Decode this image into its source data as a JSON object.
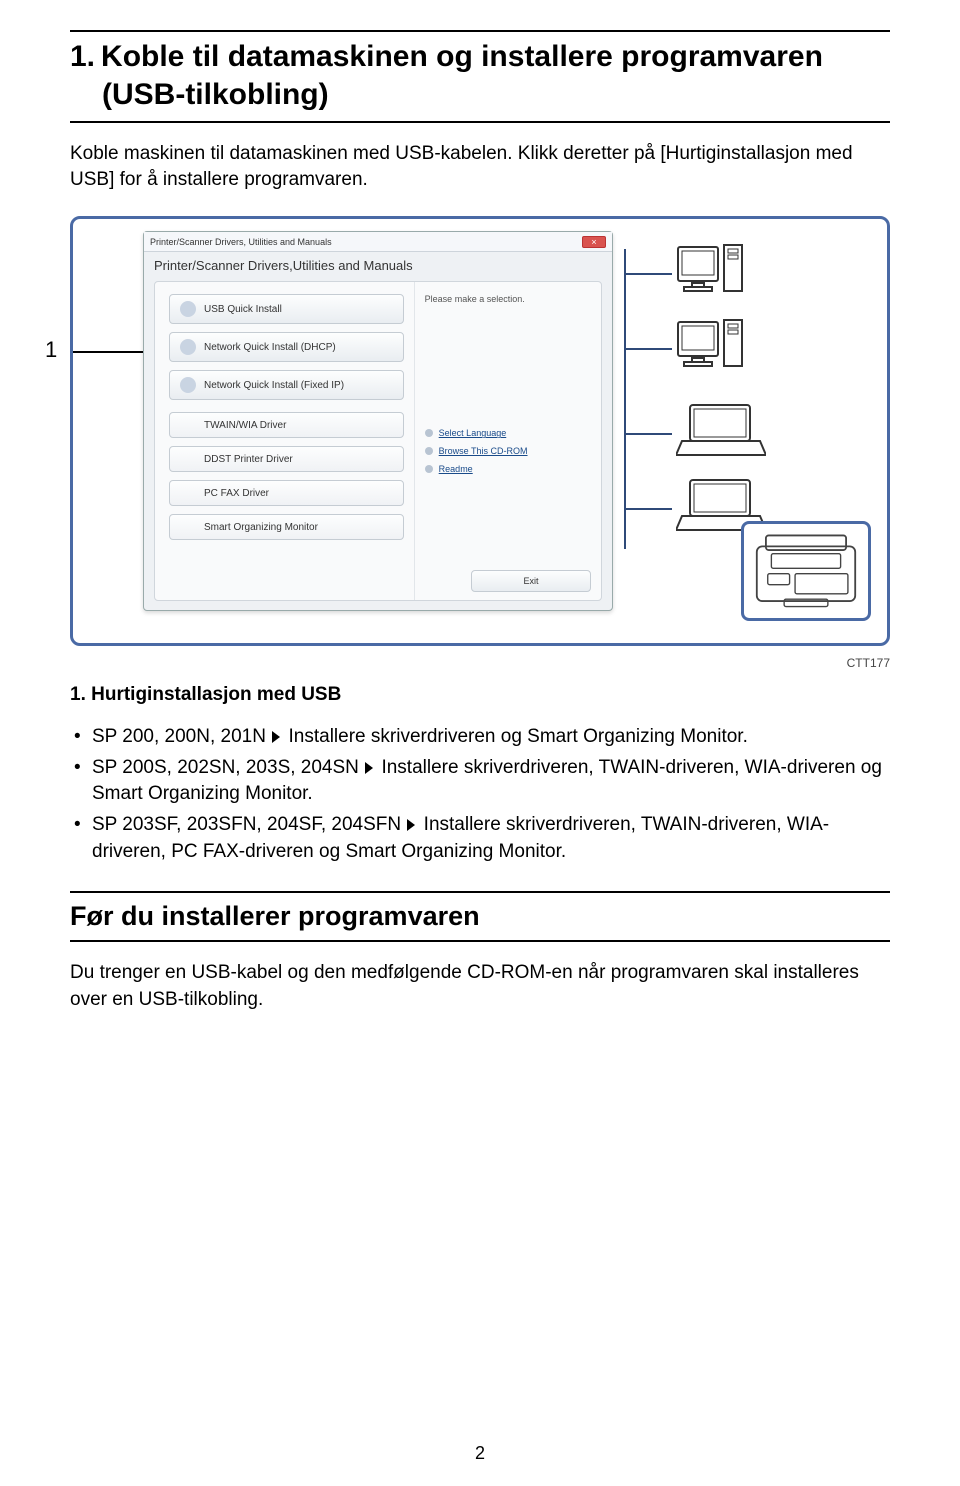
{
  "page": {
    "number": "2",
    "ref_code": "CTT177"
  },
  "title": {
    "num": "1.",
    "line1": "Koble til datamaskinen og installere programvaren",
    "line2": "(USB-tilkobling)"
  },
  "intro": "Koble maskinen til datamaskinen med USB-kabelen. Klikk deretter på [Hurtiginstallasjon med USB] for å installere programvaren.",
  "caption": "1. Hurtiginstallasjon med USB",
  "leader_number": "1",
  "bullets": [
    {
      "models": "SP 200, 200N, 201N",
      "text": "Installere skriverdriveren og Smart Organizing Monitor."
    },
    {
      "models": "SP 200S, 202SN, 203S, 204SN",
      "text": "Installere skriverdriveren, TWAIN-driveren, WIA-driveren og Smart Organizing Monitor."
    },
    {
      "models": "SP 203SF, 203SFN, 204SF, 204SFN",
      "text": "Installere skriverdriveren, TWAIN-driveren, WIA-driveren, PC FAX-driveren og Smart Organizing Monitor."
    }
  ],
  "section2": {
    "heading": "Før du installerer programvaren",
    "body": "Du trenger en USB-kabel og den medfølgende CD-ROM-en når programvaren skal installeres over en USB-tilkobling."
  },
  "dialog": {
    "titlebar": "Printer/Scanner Drivers, Utilities and Manuals",
    "header": "Printer/Scanner Drivers,Utilities and Manuals",
    "right_info": "Please make a selection.",
    "buttons_primary": [
      "USB Quick Install",
      "Network Quick Install (DHCP)",
      "Network Quick Install (Fixed IP)"
    ],
    "buttons_secondary": [
      "TWAIN/WIA Driver",
      "DDST Printer Driver",
      "PC FAX Driver",
      "Smart Organizing Monitor"
    ],
    "links": [
      "Select Language",
      "Browse This CD-ROM",
      "Readme"
    ],
    "exit": "Exit"
  }
}
